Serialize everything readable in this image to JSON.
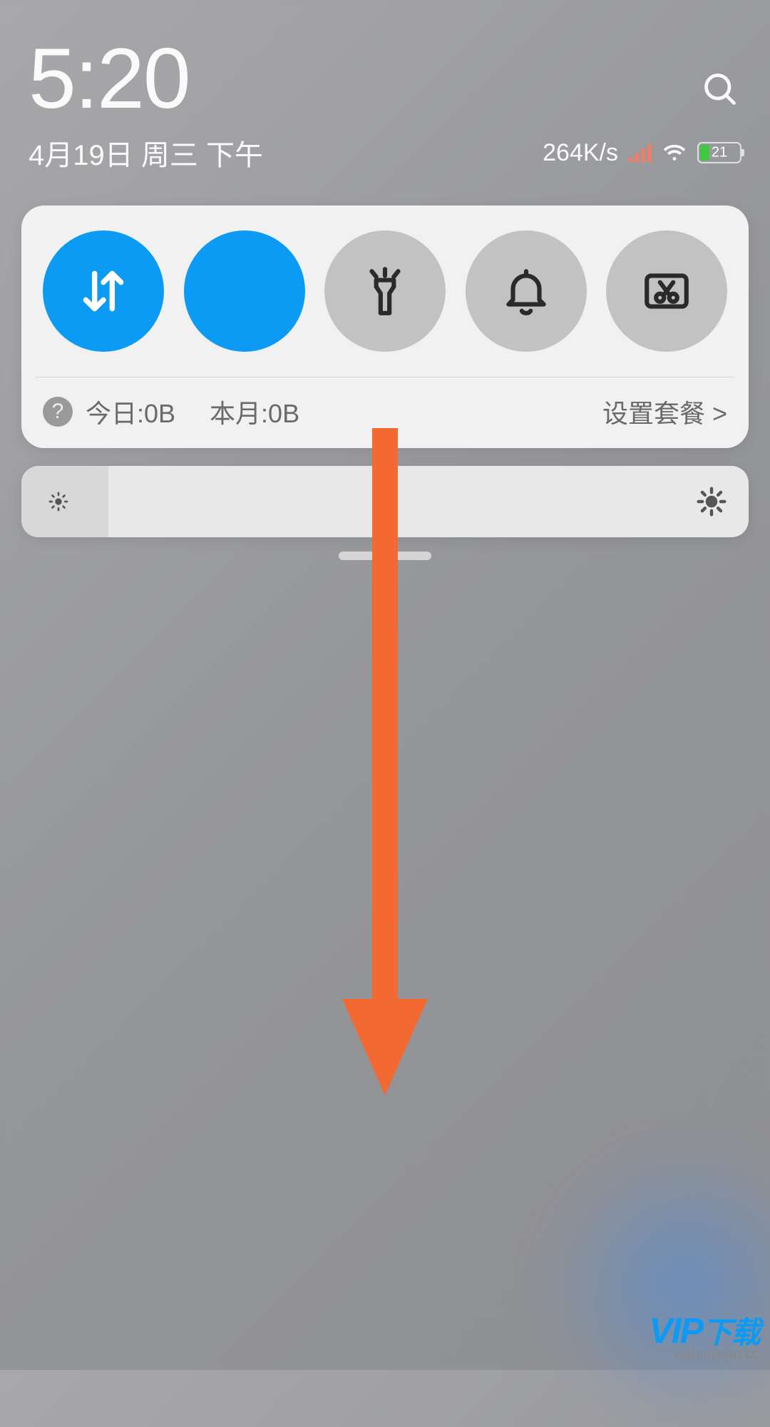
{
  "header": {
    "time": "5:20",
    "date": "4月19日 周三 下午",
    "net_speed": "264K/s",
    "battery_percent": "21"
  },
  "toggles": [
    {
      "name": "mobile-data",
      "icon": "data-swap",
      "active": true
    },
    {
      "name": "wifi",
      "icon": "wifi",
      "active": true
    },
    {
      "name": "flashlight",
      "icon": "flashlight",
      "active": false
    },
    {
      "name": "silent",
      "icon": "bell",
      "active": false
    },
    {
      "name": "screenshot",
      "icon": "scissors-screen",
      "active": false
    }
  ],
  "data_usage": {
    "today_label": "今日:0B",
    "month_label": "本月:0B",
    "plan_link": "设置套餐 >"
  },
  "brightness": {
    "level_percent": 12
  },
  "watermark": {
    "brand": "VIP",
    "suffix": "下载",
    "url": "viphuiyuan.cc"
  }
}
